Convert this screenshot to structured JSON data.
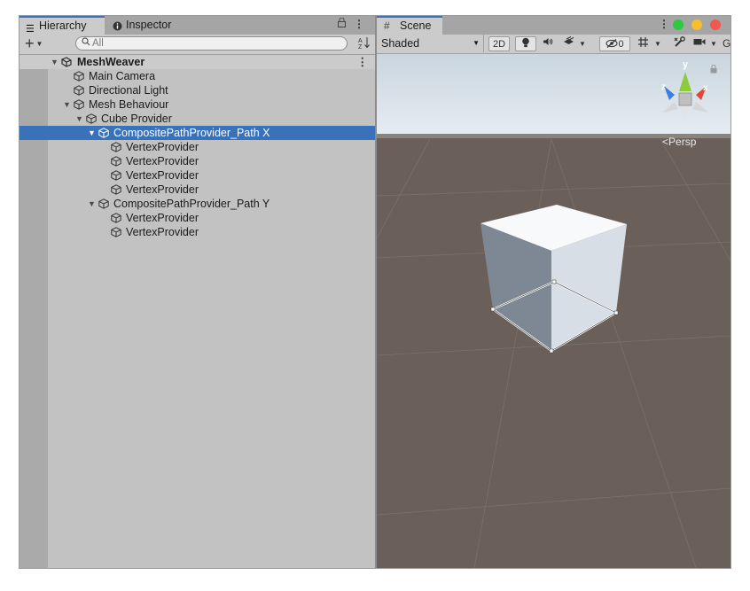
{
  "left_panel": {
    "tabs": [
      {
        "label": "Hierarchy",
        "icon": "list-icon",
        "active": true
      },
      {
        "label": "Inspector",
        "icon": "info-icon",
        "active": false
      }
    ],
    "search": {
      "placeholder": "All",
      "value": ""
    },
    "tree": [
      {
        "label": "MeshWeaver",
        "type": "scene",
        "depth": 0,
        "expanded": true
      },
      {
        "label": "Main Camera",
        "type": "object",
        "depth": 1
      },
      {
        "label": "Directional Light",
        "type": "object",
        "depth": 1
      },
      {
        "label": "Mesh Behaviour",
        "type": "object",
        "depth": 1,
        "expanded": true
      },
      {
        "label": "Cube Provider",
        "type": "object",
        "depth": 2,
        "expanded": true
      },
      {
        "label": "CompositePathProvider_Path X",
        "type": "object",
        "depth": 3,
        "expanded": true,
        "selected": true
      },
      {
        "label": "VertexProvider",
        "type": "object",
        "depth": 4
      },
      {
        "label": "VertexProvider",
        "type": "object",
        "depth": 4
      },
      {
        "label": "VertexProvider",
        "type": "object",
        "depth": 4
      },
      {
        "label": "VertexProvider",
        "type": "object",
        "depth": 4
      },
      {
        "label": "CompositePathProvider_Path Y",
        "type": "object",
        "depth": 3,
        "expanded": true
      },
      {
        "label": "VertexProvider",
        "type": "object",
        "depth": 4
      },
      {
        "label": "VertexProvider",
        "type": "object",
        "depth": 4
      }
    ]
  },
  "scene_panel": {
    "tab_label": "Scene",
    "draw_mode": "Shaded",
    "mode_2d_label": "2D",
    "hidden_count": "0",
    "gizmo_axes": {
      "x": "x",
      "y": "y",
      "z": "z"
    },
    "projection_label": "Persp"
  },
  "colors": {
    "selection": "#3a72b9",
    "panel_bg": "#c2c2c2",
    "ground": "#6a6059",
    "sky": "#cfd9e2",
    "axis_x": "#e0463a",
    "axis_y": "#8ecb3c",
    "axis_z": "#3a7de0",
    "traffic_green": "#2bc840",
    "traffic_yellow": "#f5be2e",
    "traffic_red": "#f0594f"
  }
}
